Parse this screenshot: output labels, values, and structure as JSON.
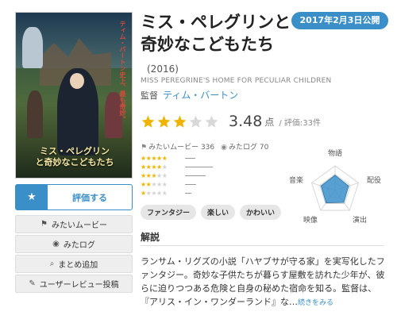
{
  "poster": {
    "title_line1": "ミス・ペレグリン",
    "title_line2": "と奇妙なこどもたち",
    "tagline": "ティム・バートン史上、最も奇妙。"
  },
  "movie": {
    "title": "ミス・ペレグリンと奇妙なこどもたち",
    "year": "(2016)",
    "release_badge": "2017年2月3日公開",
    "original_title": "MISS PEREGRINE'S HOME FOR PECULIAR CHILDREN",
    "director_label": "監督",
    "director_name": "ティム・バートン"
  },
  "rating": {
    "score": "3.48",
    "unit": "点",
    "count": "/ 評価:33件",
    "stars_filled": 3,
    "stars_total": 5
  },
  "stats": {
    "want_to_see": "みたいムービー 336",
    "watched_log": "みたログ 70"
  },
  "distribution": [
    {
      "stars": 5,
      "bar": 0.08
    },
    {
      "stars": 4,
      "bar": 0.22
    },
    {
      "stars": 3,
      "bar": 0.16
    },
    {
      "stars": 2,
      "bar": 0.09
    },
    {
      "stars": 1,
      "bar": 0.05
    }
  ],
  "radar": {
    "labels": [
      "物語",
      "配役",
      "演出",
      "映像",
      "音楽"
    ],
    "values": [
      0.62,
      0.58,
      0.6,
      0.62,
      0.6
    ]
  },
  "tags": [
    "ファンタジー",
    "楽しい",
    "かわいい"
  ],
  "section_title": "解説",
  "summary": "ランサム・リグズの小説「ハヤブサが守る家」を実写化したファンタジー。奇妙な子供たちが暮らす屋敷を訪れた少年が、彼らに迫りつつある危険と自身の秘めた宿命を知る。監督は、『アリス・イン・ワンダーランド』な…",
  "more_link": "続きをみる",
  "buttons": {
    "rate": "評価する",
    "want": "みたいムービー",
    "watched": "みたログ",
    "add_collection": "まとめ追加",
    "review": "ユーザーレビュー投稿"
  },
  "colors": {
    "accent": "#3a8fc9",
    "star": "#f0b400"
  }
}
